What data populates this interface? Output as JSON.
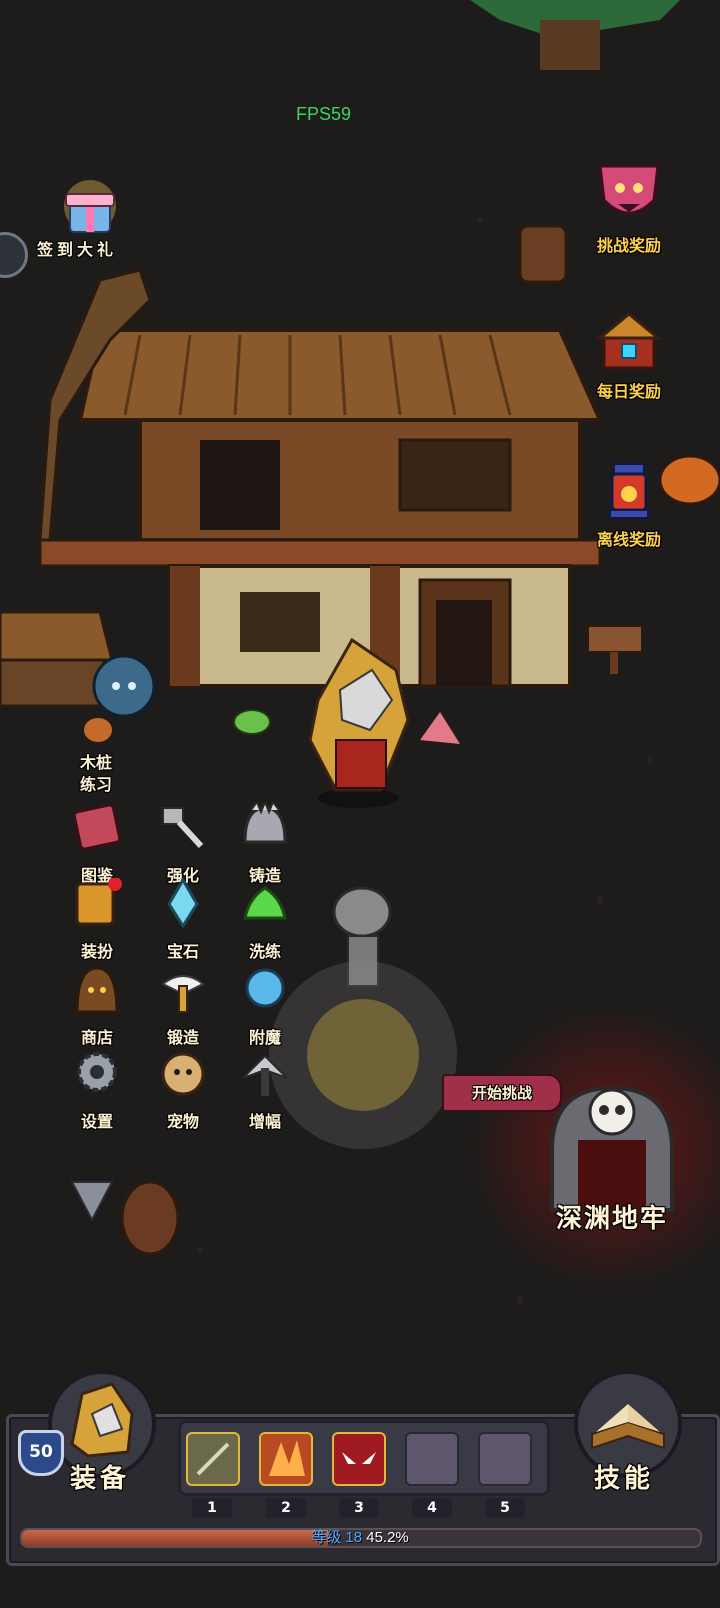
{
  "hud": {
    "fps": "FPS59"
  },
  "top_left": {
    "checkin_label": "签到大礼"
  },
  "right_rewards": [
    {
      "label": "挑战奖励",
      "icon": "demon-shield-icon"
    },
    {
      "label": "每日奖励",
      "icon": "treasure-chest-icon"
    },
    {
      "label": "离线奖励",
      "icon": "lantern-icon"
    }
  ],
  "npc": {
    "training_label": "木桩\n练习"
  },
  "menu": {
    "items": [
      {
        "label": "图鉴",
        "icon": "book-icon"
      },
      {
        "label": "强化",
        "icon": "hammer-icon"
      },
      {
        "label": "铸造",
        "icon": "helmet-icon"
      },
      {
        "label": "装扮",
        "icon": "wardrobe-icon"
      },
      {
        "label": "宝石",
        "icon": "gem-icon"
      },
      {
        "label": "洗练",
        "icon": "slime-icon"
      },
      {
        "label": "商店",
        "icon": "hooded-merchant-icon"
      },
      {
        "label": "锻造",
        "icon": "winged-sword-icon"
      },
      {
        "label": "附魔",
        "icon": "magic-orb-icon"
      },
      {
        "label": "设置",
        "icon": "gear-icon"
      },
      {
        "label": "宠物",
        "icon": "pet-icon"
      },
      {
        "label": "增幅",
        "icon": "dark-wings-icon"
      }
    ]
  },
  "dungeon": {
    "start_label": "开始挑战",
    "name": "深渊地牢"
  },
  "bottom": {
    "level": "50",
    "equip_label": "装备",
    "skill_label": "技能",
    "slots": [
      "1",
      "2",
      "3",
      "4",
      "5"
    ],
    "xp_level_text": "等级 18",
    "xp_percent_text": "45.2%",
    "xp_fraction": 0.452
  },
  "colors": {
    "fps": "#3fd35a",
    "label_gold": "#ffd24a",
    "xp_fill": "#c9694a",
    "panel": "#2b2a30"
  }
}
